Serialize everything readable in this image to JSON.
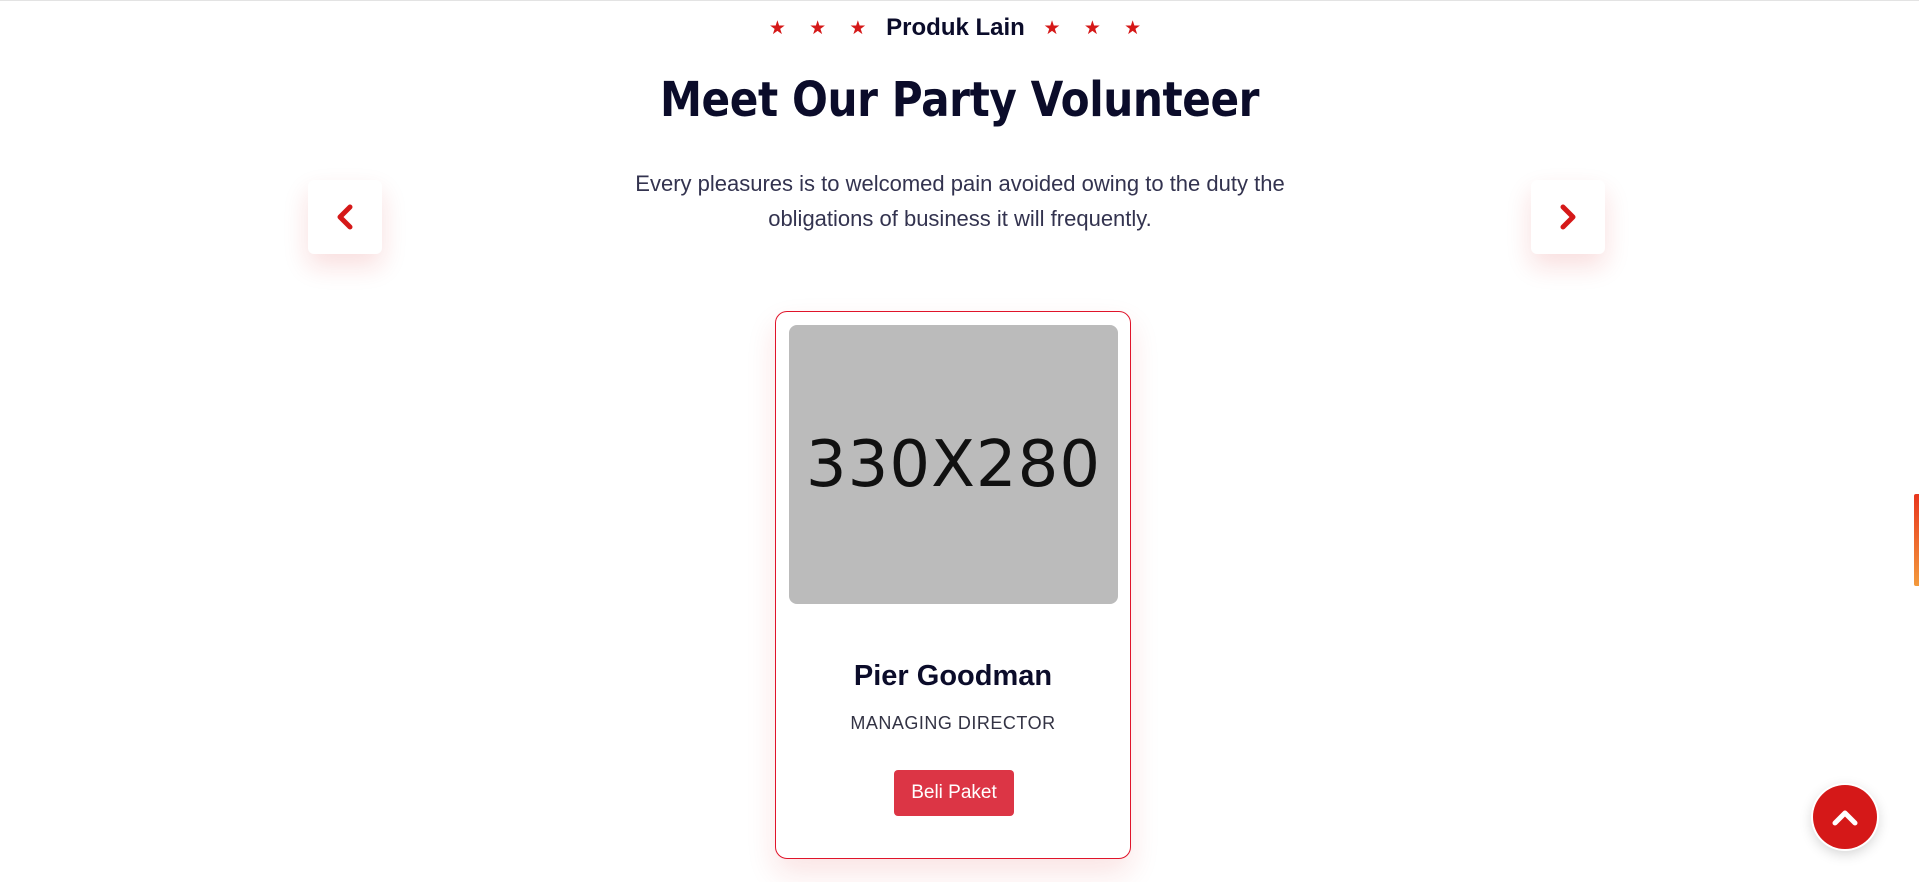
{
  "section": {
    "stars": "★ ★ ★",
    "eyebrow": "Produk Lain",
    "title": "Meet Our Party Volunteer",
    "subtitle": "Every pleasures is to welcomed pain avoided owing to the duty the obligations of business it will frequently."
  },
  "carousel": {
    "prev_icon": "chevron-left-icon",
    "next_icon": "chevron-right-icon"
  },
  "card": {
    "image_placeholder": "330X280",
    "name": "Pier Goodman",
    "role": "MANAGING DIRECTOR",
    "button_label": "Beli Paket"
  },
  "scroll_top": {
    "icon": "chevron-up-icon"
  },
  "colors": {
    "accent": "#d51818",
    "heading": "#0b0c2a",
    "button": "#dc3545",
    "placeholder": "#bbbbbb"
  }
}
